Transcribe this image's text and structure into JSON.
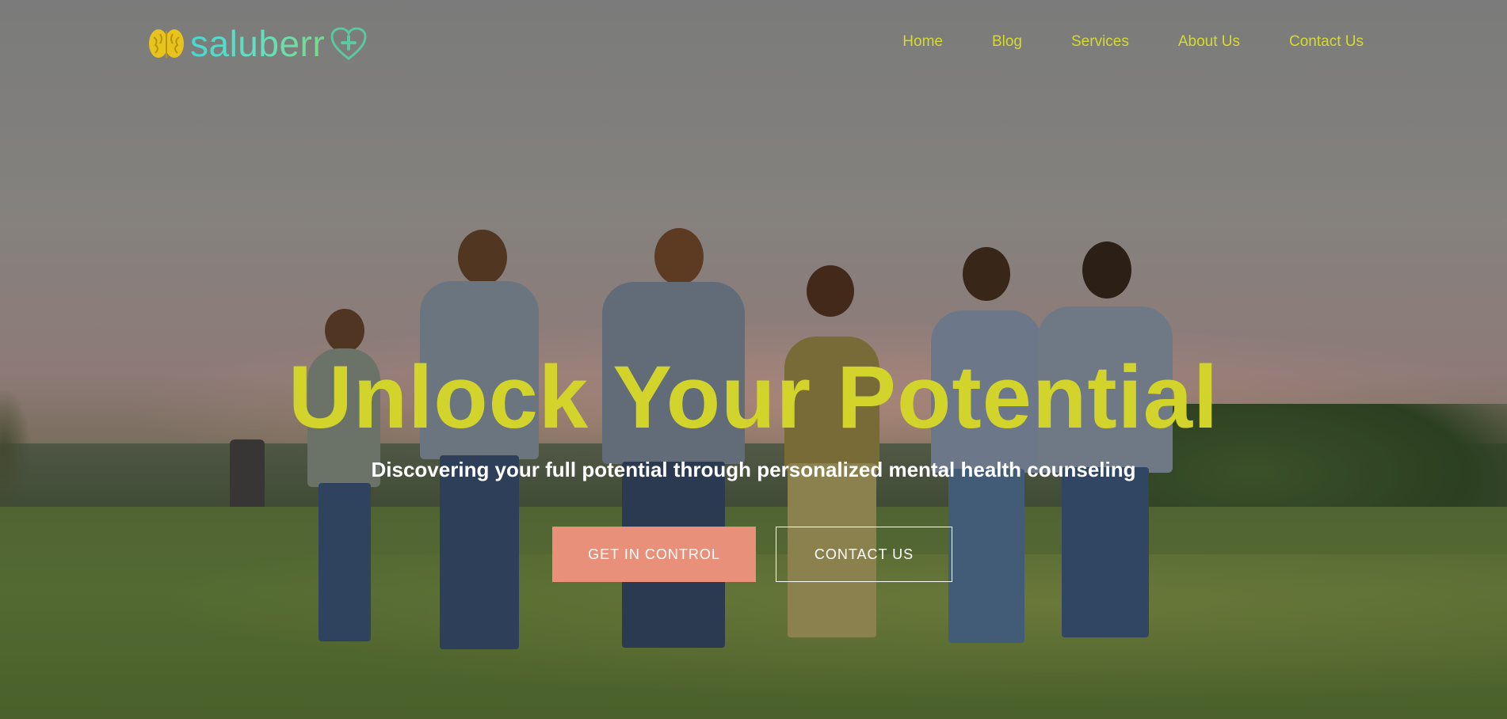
{
  "brand": {
    "name": "saluberr",
    "brain_icon": "brain-icon",
    "heart_icon": "heart-plus-icon",
    "colors": {
      "brain": "#e9c31d",
      "text": "#49d7d2",
      "heart": "#5bc8a0"
    }
  },
  "nav": {
    "items": [
      {
        "label": "Home"
      },
      {
        "label": "Blog"
      },
      {
        "label": "Services"
      },
      {
        "label": "About Us"
      },
      {
        "label": "Contact Us"
      }
    ],
    "color": "#d6da2f"
  },
  "hero": {
    "title": "Unlock Your Potential",
    "subtitle": "Discovering your full potential through personalized mental health counseling",
    "primary_cta": "GET IN CONTROL",
    "secondary_cta": "CONTACT US",
    "colors": {
      "title": "#d2d32b",
      "primary_button": "#e8907a"
    }
  }
}
